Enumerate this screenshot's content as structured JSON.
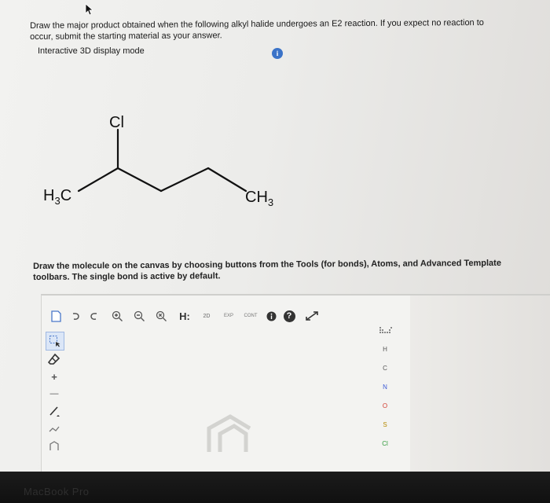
{
  "question": {
    "line1": "Draw the major product obtained when the following alkyl halide undergoes an E2 reaction. If you expect no reaction to",
    "line2": "occur, submit the starting material as your answer.",
    "mode_label": "Interactive 3D display mode",
    "info_icon": "i"
  },
  "molecule": {
    "cl": "Cl",
    "h3c_main": "H",
    "h3c_sub": "3",
    "h3c_tail": "C",
    "ch3_main": "CH",
    "ch3_sub": "3"
  },
  "instructions": {
    "line1": "Draw the molecule on the canvas by choosing buttons from the Tools (for bonds), Atoms, and Advanced Template",
    "line2": "toolbars. The single bond is active by default."
  },
  "toolbar": {
    "explicit_h": "H:",
    "label_2d": "2D",
    "label_exp": "EXP",
    "label_cont": "CONT",
    "help": "?"
  },
  "tools": {
    "plus": "+",
    "minus": "—"
  },
  "atoms": [
    "H",
    "C",
    "N",
    "O",
    "S",
    "Cl"
  ],
  "atom_colors": {
    "H": "#555555",
    "C": "#555555",
    "N": "#3b59d6",
    "O": "#d23b2f",
    "S": "#b58a00",
    "Cl": "#2f9a3b"
  },
  "bezel": {
    "brand": "MacBook Pro"
  }
}
